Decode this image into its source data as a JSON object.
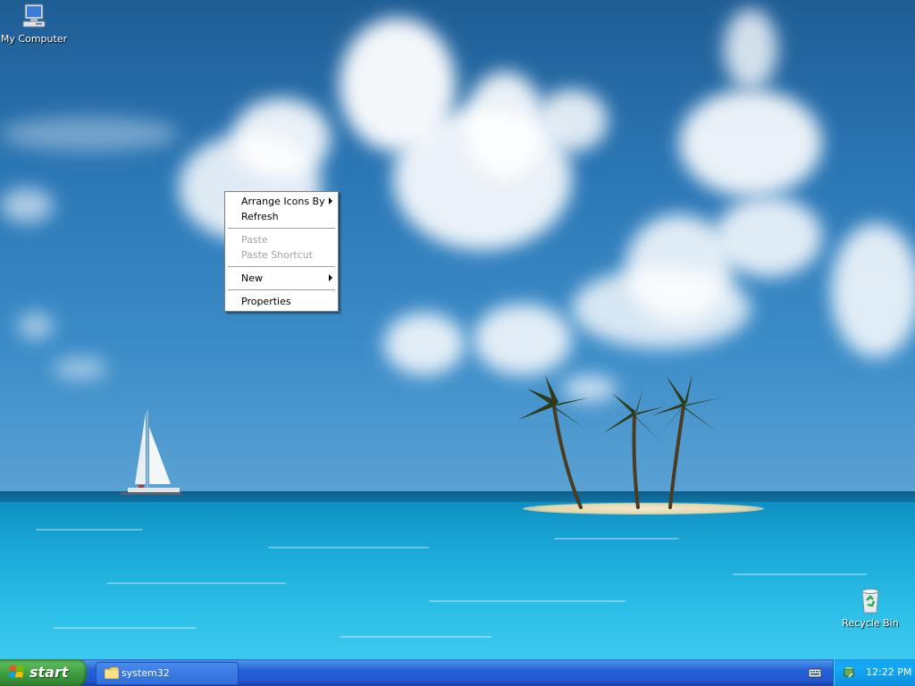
{
  "desktop": {
    "icons": [
      {
        "name": "my-computer",
        "label": "My Computer"
      },
      {
        "name": "recycle-bin",
        "label": "Recycle Bin"
      }
    ]
  },
  "context_menu": {
    "items": [
      {
        "label": "Arrange Icons By",
        "submenu": true,
        "enabled": true
      },
      {
        "label": "Refresh",
        "submenu": false,
        "enabled": true
      },
      {
        "label": "Paste",
        "submenu": false,
        "enabled": false
      },
      {
        "label": "Paste Shortcut",
        "submenu": false,
        "enabled": false
      },
      {
        "label": "New",
        "submenu": true,
        "enabled": true
      },
      {
        "label": "Properties",
        "submenu": false,
        "enabled": true
      }
    ]
  },
  "taskbar": {
    "start_label": "start",
    "windows": [
      {
        "label": "system32",
        "icon": "folder-icon"
      }
    ],
    "tray": {
      "clock": "12:22 PM"
    }
  },
  "colors": {
    "taskbar_blue": "#2157d0",
    "start_green": "#3a9a3a",
    "tray_blue": "#13aaf5",
    "menu_disabled": "#a3a3a3"
  }
}
